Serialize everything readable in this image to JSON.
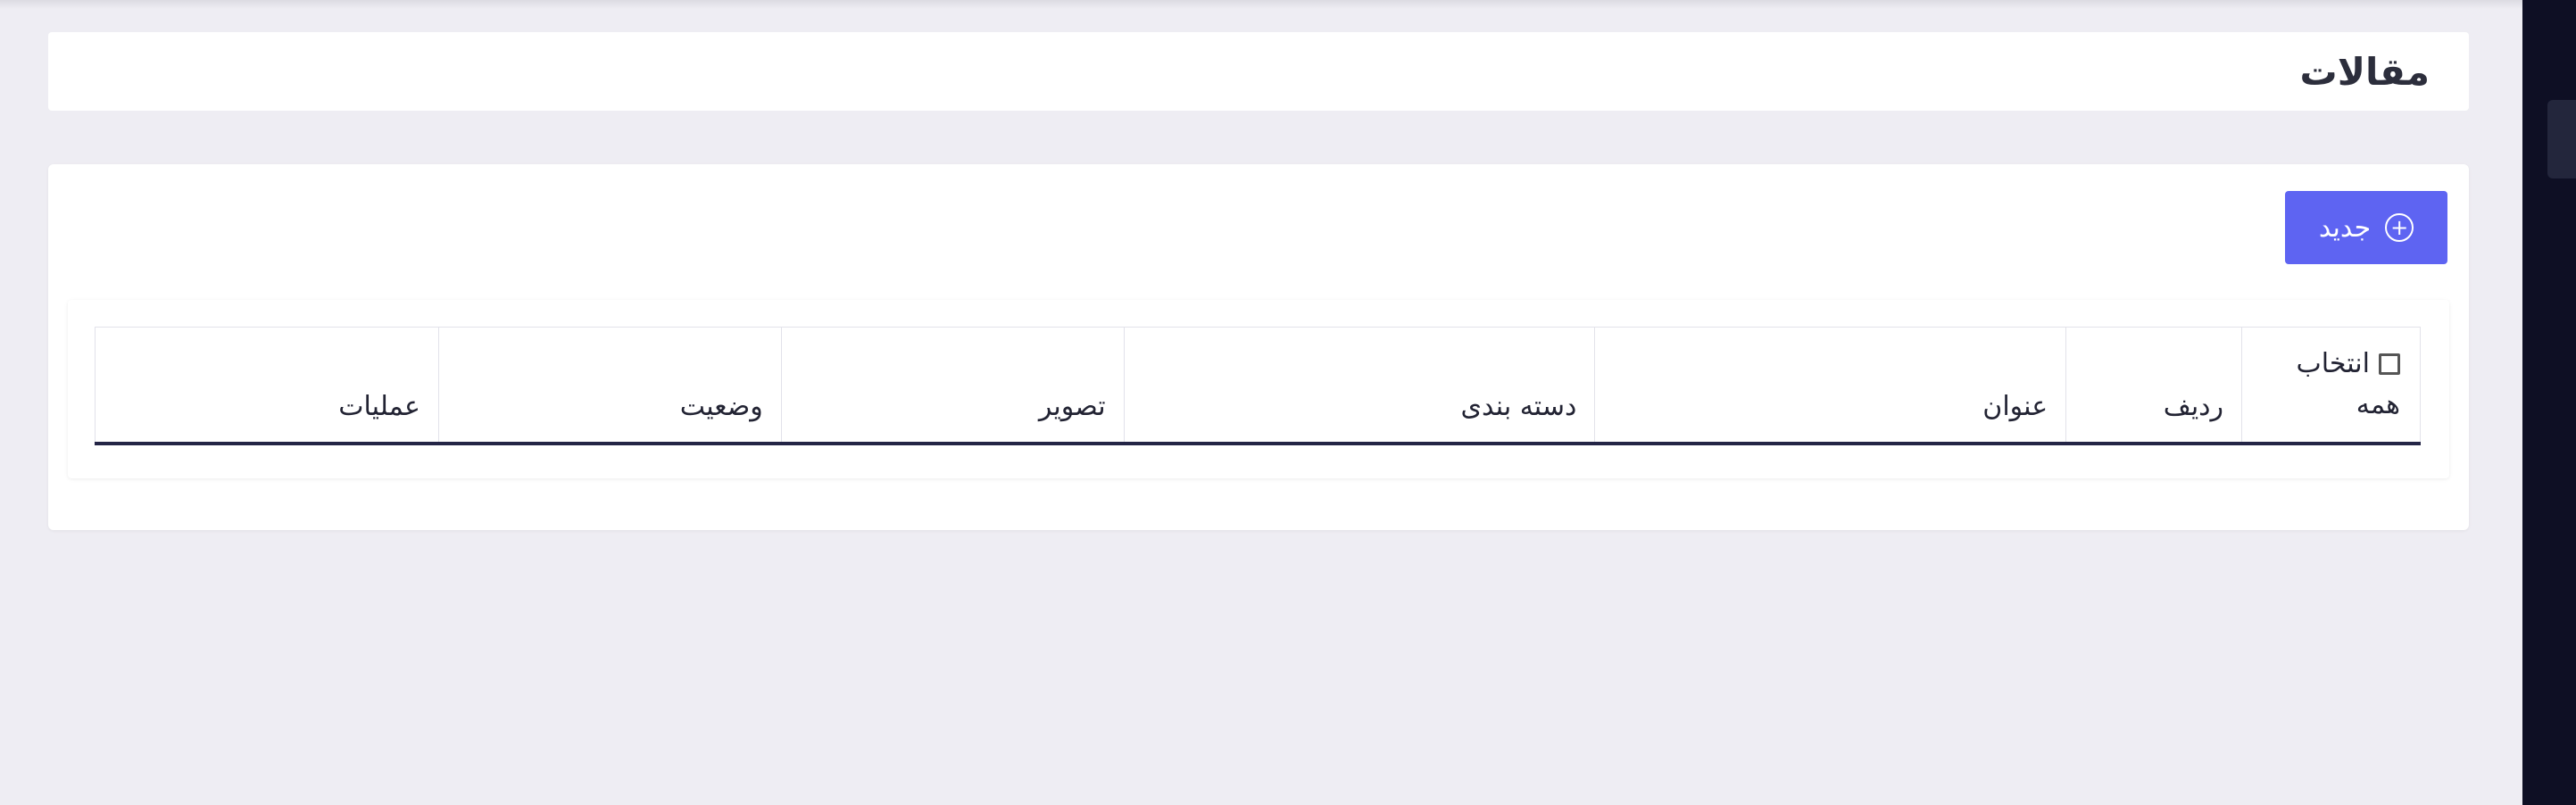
{
  "page": {
    "title": "مقالات"
  },
  "toolbar": {
    "new_label": "جدید",
    "new_icon": "plus-circle-icon"
  },
  "table": {
    "select_all_label": "انتخاب همه",
    "columns": [
      "ردیف",
      "عنوان",
      "دسته بندی",
      "تصویر",
      "وضعیت",
      "عملیات"
    ],
    "rows": []
  },
  "colors": {
    "accent": "#5e64f2",
    "sidebar": "#0e0f24",
    "background": "#eeedf3",
    "table_header_rule": "#242546"
  }
}
